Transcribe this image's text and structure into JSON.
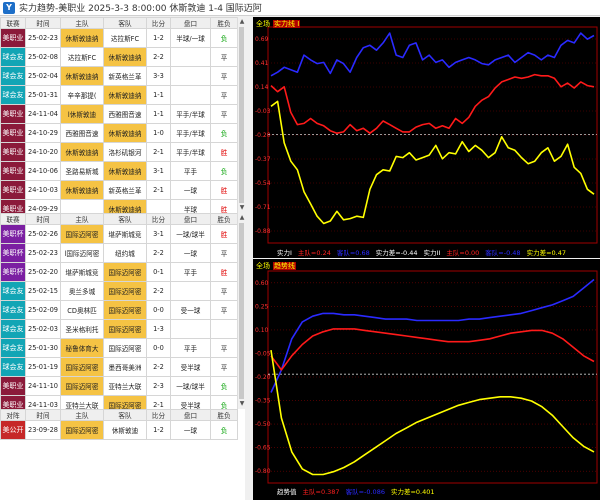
{
  "window": {
    "title": "实力趋势-美职业 2025-3-3 8:00:00 休斯敦迪 1-4 国际迈阿"
  },
  "table1": {
    "headers": [
      "联赛",
      "时间",
      "主队",
      "客队",
      "比分",
      "盘口",
      "胜负"
    ],
    "rows": [
      {
        "league": "美职业",
        "color": "#8b1a3a",
        "date": "25-02-23",
        "home": "休斯敦迪纳",
        "away": "达拉斯FC",
        "score": "1-2",
        "handicap": "半球/一球",
        "result": "负",
        "hl": "home"
      },
      {
        "league": "球会友",
        "color": "#12a5b5",
        "date": "25-02-08",
        "home": "达拉斯FC",
        "away": "休斯敦迪纳",
        "score": "2-2",
        "handicap": "",
        "result": "平",
        "hl": "away"
      },
      {
        "league": "球会友",
        "color": "#12a5b5",
        "date": "25-02-04",
        "home": "休斯敦迪纳",
        "away": "新英格兰革",
        "score": "3-3",
        "handicap": "",
        "result": "平",
        "hl": "home"
      },
      {
        "league": "球会友",
        "color": "#12a5b5",
        "date": "25-01-31",
        "home": "辛辛那提(",
        "away": "休斯敦迪纳",
        "score": "1-1",
        "handicap": "",
        "result": "平",
        "hl": "away"
      },
      {
        "league": "美职业",
        "color": "#8b1a3a",
        "date": "24-11-04",
        "home": "l休斯敦迪",
        "away": "西雅图音速",
        "score": "1-1",
        "handicap": "平手/半球",
        "result": "平",
        "hl": "home"
      },
      {
        "league": "美职业",
        "color": "#8b1a3a",
        "date": "24-10-29",
        "home": "西雅图音速",
        "away": "休斯敦迪纳",
        "score": "1-0",
        "handicap": "平手/半球",
        "result": "负",
        "hl": "away"
      },
      {
        "league": "美职业",
        "color": "#8b1a3a",
        "date": "24-10-20",
        "home": "休斯敦迪纳",
        "away": "洛杉矶银河",
        "score": "2-1",
        "handicap": "平手/半球",
        "result": "胜",
        "hl": "home"
      },
      {
        "league": "美职业",
        "color": "#8b1a3a",
        "date": "24-10-06",
        "home": "圣路易斯城",
        "away": "休斯敦迪纳",
        "score": "3-1",
        "handicap": "平手",
        "result": "负",
        "hl": "away"
      },
      {
        "league": "美职业",
        "color": "#8b1a3a",
        "date": "24-10-03",
        "home": "休斯敦迪纳",
        "away": "新英格兰革",
        "score": "2-1",
        "handicap": "一球",
        "result": "胜",
        "hl": "home"
      },
      {
        "league": "美职业",
        "color": "#8b1a3a",
        "date": "24-09-29",
        "home": "",
        "away": "休斯敦迪纳",
        "score": "",
        "handicap": "半球",
        "result": "胜",
        "hl": "away"
      }
    ]
  },
  "table2": {
    "headers": [
      "联赛",
      "时间",
      "主队",
      "客队",
      "比分",
      "盘口",
      "胜负"
    ],
    "rows": [
      {
        "league": "美职杯",
        "color": "#7b1fa2",
        "date": "25-02-26",
        "home": "国际迈阿密",
        "away": "堪萨斯城竞",
        "score": "3-1",
        "handicap": "一球/球半",
        "result": "胜",
        "hl": "home"
      },
      {
        "league": "美职杯",
        "color": "#7b1fa2",
        "date": "25-02-23",
        "home": "l国际迈阿密",
        "away": "纽约城",
        "score": "2-2",
        "handicap": "一球",
        "result": "平",
        "hl": "none"
      },
      {
        "league": "美职杯",
        "color": "#7b1fa2",
        "date": "25-02-20",
        "home": "堪萨斯城竞",
        "away": "国际迈阿密",
        "score": "0-1",
        "handicap": "平手",
        "result": "胜",
        "hl": "away"
      },
      {
        "league": "球会友",
        "color": "#12a5b5",
        "date": "25-02-15",
        "home": "奥兰多城",
        "away": "国际迈阿密",
        "score": "2-2",
        "handicap": "",
        "result": "平",
        "hl": "away"
      },
      {
        "league": "球会友",
        "color": "#12a5b5",
        "date": "25-02-09",
        "home": "CD奥林匹",
        "away": "国际迈阿密",
        "score": "0-0",
        "handicap": "受一球",
        "result": "平",
        "hl": "away"
      },
      {
        "league": "球会友",
        "color": "#12a5b5",
        "date": "25-02-03",
        "home": "圣米格利托",
        "away": "国际迈阿密",
        "score": "1-3",
        "handicap": "",
        "result": "",
        "hl": "away"
      },
      {
        "league": "球会友",
        "color": "#12a5b5",
        "date": "25-01-30",
        "home": "秘鲁体育大",
        "away": "国际迈阿密",
        "score": "0-0",
        "handicap": "平手",
        "result": "平",
        "hl": "home"
      },
      {
        "league": "球会友",
        "color": "#12a5b5",
        "date": "25-01-19",
        "home": "国际迈阿密",
        "away": "墨西哥美洲",
        "score": "2-2",
        "handicap": "受半球",
        "result": "平",
        "hl": "home"
      },
      {
        "league": "美职业",
        "color": "#8b1a3a",
        "date": "24-11-10",
        "home": "国际迈阿密",
        "away": "亚特兰大联",
        "score": "2-3",
        "handicap": "一球/球半",
        "result": "负",
        "hl": "home"
      },
      {
        "league": "美职业",
        "color": "#8b1a3a",
        "date": "24-11-03",
        "home": "亚特兰大联",
        "away": "国际迈阿密",
        "score": "2-1",
        "handicap": "受半球",
        "result": "负",
        "hl": "away"
      }
    ]
  },
  "table3": {
    "headers": [
      "对阵",
      "时间",
      "主队",
      "客队",
      "比分",
      "盘口",
      "胜负"
    ],
    "rows": [
      {
        "league": "美公开",
        "color": "#c62828",
        "date": "23-09-28",
        "home": "国际迈阿密",
        "away": "休斯敦迪",
        "score": "1-2",
        "handicap": "一球",
        "result": "负",
        "hl": "home"
      }
    ]
  },
  "chart1": {
    "tag": "全场",
    "title": "实力线 I",
    "legend": [
      {
        "label": "实力I",
        "color": "#ffffff"
      },
      {
        "label": "主队=0.24",
        "color": "#ff2020"
      },
      {
        "label": "客队=0.68",
        "color": "#2a2aff"
      },
      {
        "label": "实力差=-0.44",
        "color": "#ffffff"
      },
      {
        "label": "实力II",
        "color": "#ffffff"
      },
      {
        "label": "主队=0.00",
        "color": "#ff2020"
      },
      {
        "label": "客队=-0.48",
        "color": "#2a2aff"
      },
      {
        "label": "实力差=0.47",
        "color": "#ffff00"
      }
    ],
    "ylabels": [
      "0.69",
      "0.41",
      "0.14",
      "-0.03",
      "-0.20",
      "-0.37",
      "-0.54",
      "-0.71",
      "-0.88"
    ],
    "blue": [
      0.45,
      0.48,
      0.52,
      0.5,
      0.48,
      0.62,
      0.58,
      0.55,
      0.56,
      0.47,
      0.58,
      0.55,
      0.48,
      0.6,
      0.68,
      0.7,
      0.66,
      0.72,
      0.8,
      0.62,
      0.6,
      0.7,
      0.72,
      0.58,
      0.62,
      0.56,
      0.58,
      0.52,
      0.56,
      0.58,
      0.6,
      0.58,
      0.55,
      0.54,
      0.58,
      0.6,
      0.62,
      0.56,
      0.6,
      0.64,
      0.62,
      0.58,
      0.62,
      0.6,
      0.7,
      0.74,
      0.72,
      0.8,
      0.75,
      0.78
    ],
    "red": [
      0.37,
      0.32,
      0.36,
      0.15,
      0.05,
      0.06,
      0.1,
      0.06,
      0.04,
      0.0,
      -0.02,
      -0.01,
      0.05,
      0.0,
      0.02,
      -0.02,
      0.02,
      0.08,
      0.05,
      0.02,
      -0.01,
      -0.01,
      0.03,
      0.05,
      0.06,
      0.02,
      0.04,
      0.02,
      0.1,
      0.06,
      0.11,
      0.2,
      0.25,
      0.28,
      0.35,
      0.4,
      0.42,
      0.44,
      0.43,
      0.44,
      0.46,
      0.45,
      0.45,
      0.43,
      0.36,
      0.39,
      0.35,
      0.4,
      0.37,
      0.36
    ],
    "yellow": [
      0.2,
      0.24,
      -0.1,
      -0.25,
      -0.32,
      -0.5,
      -0.6,
      -0.7,
      -0.76,
      -0.74,
      -0.66,
      -0.73,
      -0.72,
      -0.7,
      -0.71,
      -0.48,
      -0.36,
      -0.32,
      -0.33,
      -0.21,
      -0.22,
      -0.18,
      -0.24,
      -0.22,
      -0.2,
      -0.12,
      -0.23,
      -0.18,
      -0.19,
      -0.09,
      -0.17,
      -0.12,
      -0.16,
      -0.22,
      -0.18,
      -0.05,
      -0.14,
      -0.16,
      -0.22,
      -0.27,
      -0.25,
      -0.18,
      -0.14,
      -0.25,
      -0.21,
      -0.11,
      -0.3,
      -0.35,
      -0.48,
      -0.52
    ]
  },
  "chart2": {
    "tag": "全场",
    "title": "趋势线",
    "legend": [
      {
        "label": "趋势值",
        "color": "#ffffff"
      },
      {
        "label": "主队=0.387",
        "color": "#ff2020"
      },
      {
        "label": "客队=-0.086",
        "color": "#2a2aff"
      },
      {
        "label": "实力差=0.401",
        "color": "#ffff00"
      }
    ],
    "ylabels": [
      "0.60",
      "0.25",
      "0.10",
      "-0.05",
      "-0.20",
      "-0.35",
      "-0.50",
      "-0.65",
      "-0.80"
    ],
    "blue": [
      -0.18,
      -0.02,
      0.2,
      0.32,
      0.36,
      0.38,
      0.38,
      0.37,
      0.37,
      0.36,
      0.35,
      0.34,
      0.34,
      0.34,
      0.33,
      0.33,
      0.33,
      0.33,
      0.33,
      0.34,
      0.34,
      0.35,
      0.36,
      0.37,
      0.38,
      0.4,
      0.42,
      0.44,
      0.47,
      0.5,
      0.56,
      0.62
    ],
    "red": [
      0.08,
      -0.02,
      0.08,
      0.16,
      0.22,
      0.25,
      0.27,
      0.27,
      0.27,
      0.26,
      0.25,
      0.24,
      0.23,
      0.22,
      0.21,
      0.2,
      0.19,
      0.18,
      0.18,
      0.18,
      0.19,
      0.2,
      0.22,
      0.24,
      0.25,
      0.26,
      0.26,
      0.24,
      0.2,
      0.14,
      0.08,
      0.04
    ],
    "yellow": [
      0.12,
      -0.36,
      -0.6,
      -0.72,
      -0.76,
      -0.76,
      -0.74,
      -0.71,
      -0.67,
      -0.62,
      -0.57,
      -0.52,
      -0.47,
      -0.43,
      -0.39,
      -0.36,
      -0.33,
      -0.3,
      -0.27,
      -0.25,
      -0.23,
      -0.22,
      -0.21,
      -0.21,
      -0.22,
      -0.24,
      -0.28,
      -0.34,
      -0.42,
      -0.5,
      -0.56,
      -0.6
    ]
  }
}
